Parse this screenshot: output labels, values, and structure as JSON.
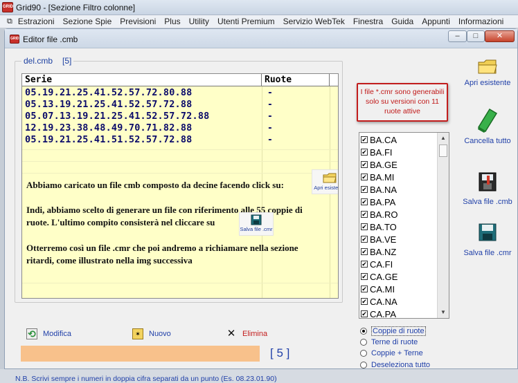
{
  "app": {
    "title": "Grid90 - [Sezione Filtro colonne]",
    "icon_text": "GRID"
  },
  "menu": [
    "Estrazioni",
    "Sezione Spie",
    "Previsioni",
    "Plus",
    "Utility",
    "Utenti Premium",
    "Servizio WebTek",
    "Finestra",
    "Guida",
    "Appunti",
    "Informazioni"
  ],
  "dialog": {
    "title": "Editor file .cmb",
    "min": "–",
    "max": "□",
    "close": "✕"
  },
  "file": {
    "name": "del.cmb",
    "count": "[5]"
  },
  "grid": {
    "headers": {
      "serie": "Serie",
      "ruote": "Ruote"
    },
    "rows": [
      {
        "serie": "05.19.21.25.41.52.57.72.80.88",
        "ruote": "-"
      },
      {
        "serie": "05.13.19.21.25.41.52.57.72.88",
        "ruote": "-"
      },
      {
        "serie": "05.07.13.19.21.25.41.52.57.72.88",
        "ruote": "-"
      },
      {
        "serie": "12.19.23.38.48.49.70.71.82.88",
        "ruote": "-"
      },
      {
        "serie": "05.19.21.25.41.51.52.57.72.88",
        "ruote": "-"
      }
    ]
  },
  "overlay": {
    "line1": "Abbiamo caricato un file cmb composto da decine facendo click su:",
    "line2a": "Indi, abbiamo scelto di generare un file con riferimento alle 55 coppie di",
    "line2b": "ruote. L'ultimo compito consisterà nel cliccare su",
    "line3a": "Otterremo così un file .cmr che poi andremo a richiamare nella sezione",
    "line3b": "ritardi, come illustrato nella img successiva",
    "mini_open": "Apri esistente",
    "mini_save": "Salva file .cmr"
  },
  "note": "I file *.cmr sono generabili solo su versioni con 11 ruote attive",
  "wheels": {
    "checkbox_mark": "✔",
    "items": [
      "BA.CA",
      "BA.FI",
      "BA.GE",
      "BA.MI",
      "BA.NA",
      "BA.PA",
      "BA.RO",
      "BA.TO",
      "BA.VE",
      "BA.NZ",
      "CA.FI",
      "CA.GE",
      "CA.MI",
      "CA.NA",
      "CA.PA"
    ]
  },
  "scroll": {
    "up": "▲",
    "down": "▼"
  },
  "radios": {
    "items": [
      "Coppie di ruote",
      "Terne di ruote",
      "Coppie + Terne",
      "Deseleziona tutto"
    ],
    "selected": "Coppie di ruote"
  },
  "side": {
    "open": "Apri esistente",
    "clear": "Cancella tutto",
    "save_cmb": "Salva file .cmb",
    "save_cmr": "Salva file .cmr"
  },
  "actions": {
    "modifica": "Modifica",
    "nuovo": "Nuovo",
    "elimina": "Elimina",
    "elimina_icon": "✕",
    "modifica_icon": "⟲",
    "nuovo_icon": "✶"
  },
  "counter": "[ 5 ]",
  "footnote": "N.B. Scrivi sempre i numeri in doppia cifra separati da un punto (Es. 08.23.01.90)",
  "colors": {
    "grid_bg": "#ffffc8",
    "accent_blue": "#1f3fa8",
    "warning_red": "#c21c1c",
    "progress": "#f8c18b"
  }
}
